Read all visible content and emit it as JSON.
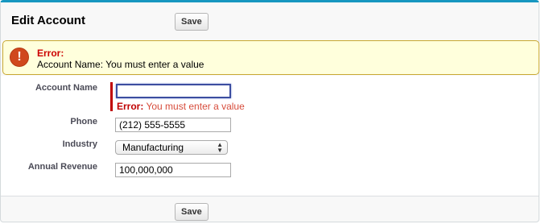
{
  "header": {
    "title": "Edit Account",
    "save_label": "Save"
  },
  "error_banner": {
    "icon": "exclamation-icon",
    "heading": "Error:",
    "message": "Account Name: You must enter a value"
  },
  "form": {
    "account_name": {
      "label": "Account Name",
      "value": "",
      "error_prefix": "Error:",
      "error_text": " You must enter a value"
    },
    "phone": {
      "label": "Phone",
      "value": "(212) 555-5555"
    },
    "industry": {
      "label": "Industry",
      "value": "Manufacturing"
    },
    "annual_revenue": {
      "label": "Annual Revenue",
      "value": "100,000,000"
    }
  },
  "footer": {
    "save_label": "Save"
  },
  "colors": {
    "accent": "#1797c0",
    "error_red": "#c00000",
    "error_icon": "#d0481d",
    "banner_bg": "#ffffdc"
  }
}
